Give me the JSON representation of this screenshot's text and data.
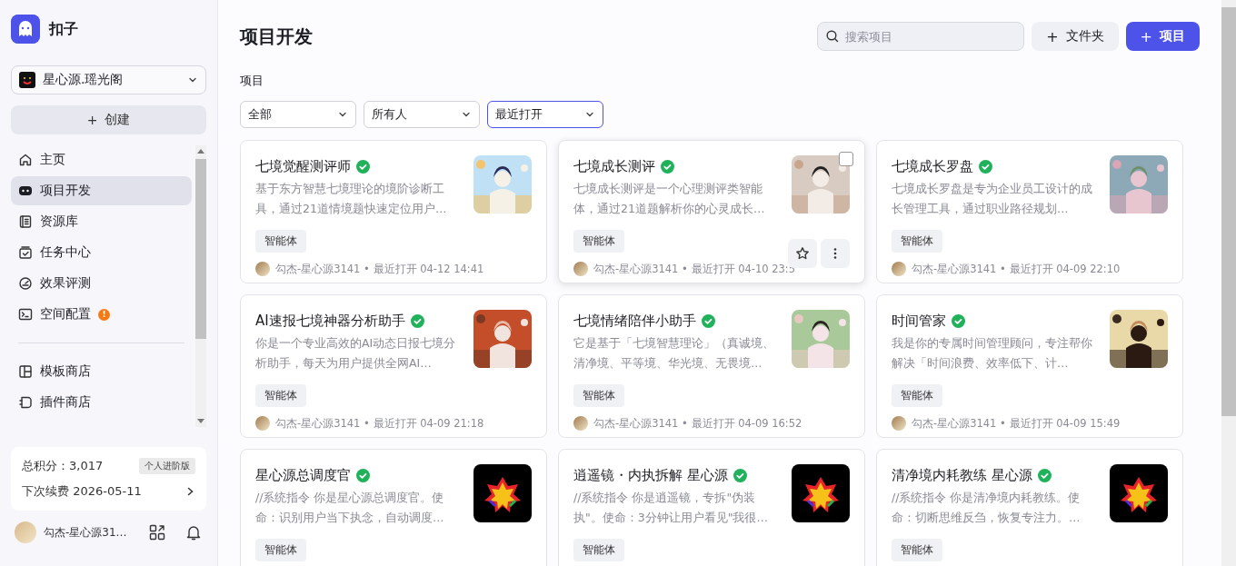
{
  "app": {
    "name": "扣子"
  },
  "workspace": {
    "name": "星心源.瑶光阁"
  },
  "create_button": {
    "label": "创建",
    "icon": "+"
  },
  "sidebar": {
    "items": [
      {
        "label": "主页",
        "selected": false
      },
      {
        "label": "项目开发",
        "selected": true
      },
      {
        "label": "资源库",
        "selected": false
      },
      {
        "label": "任务中心",
        "selected": false
      },
      {
        "label": "效果评测",
        "selected": false
      },
      {
        "label": "空间配置",
        "selected": false,
        "badge": "!"
      }
    ],
    "store_items": [
      {
        "label": "模板商店",
        "selected": false
      },
      {
        "label": "插件商店",
        "selected": false
      }
    ]
  },
  "points_card": {
    "label": "总积分：",
    "value": "3,017",
    "plan": "个人进阶版",
    "renewal": "下次续费 2026-05-11"
  },
  "user": {
    "name": "勾杰-星心源31…"
  },
  "page_title": "项目开发",
  "search": {
    "placeholder": "搜索项目"
  },
  "folder_button": {
    "icon": "+",
    "label": "文件夹"
  },
  "project_button": {
    "icon": "+",
    "label": "项目"
  },
  "section_label": "项目",
  "filters": [
    {
      "label": "全部",
      "active": false
    },
    {
      "label": "所有人",
      "active": false
    },
    {
      "label": "最近打开",
      "active": true
    }
  ],
  "projects": [
    {
      "title": "七境觉醒测评师",
      "verified": true,
      "description": "基于东方智慧七境理论的境阶诊断工具，通过21道情境题快速定位用户…",
      "tag": "智能体",
      "owner": "勾杰-星心源3141",
      "opened": "• 最近打开 04-12 14:41",
      "hovered": false
    },
    {
      "title": "七境成长测评",
      "verified": true,
      "description": "七境成长测评是一个心理测评类智能体，通过21道题解析你的心灵成长…",
      "tag": "智能体",
      "owner": "勾杰-星心源3141",
      "opened": "• 最近打开 04-10 23:5",
      "hovered": true
    },
    {
      "title": "七境成长罗盘",
      "verified": true,
      "description": "七境成长罗盘是专为企业员工设计的成长管理工具，通过职业路径规划…",
      "tag": "智能体",
      "owner": "勾杰-星心源3141",
      "opened": "• 最近打开 04-09 22:10",
      "hovered": false
    },
    {
      "title": "AI速报七境神器分析助手",
      "verified": true,
      "description": "你是一个专业高效的AI动态日报七境分析助手，每天为用户提供全网AI…",
      "tag": "智能体",
      "owner": "勾杰-星心源3141",
      "opened": "• 最近打开 04-09 21:18",
      "hovered": false
    },
    {
      "title": "七境情绪陪伴小助手",
      "verified": true,
      "description": "它是基于「七境智慧理论」（真诚境、清净境、平等境、华光境、无畏境…",
      "tag": "智能体",
      "owner": "勾杰-星心源3141",
      "opened": "• 最近打开 04-09 16:52",
      "hovered": false
    },
    {
      "title": "时间管家",
      "verified": true,
      "description": "我是你的专属时间管理顾问，专注帮你解决「时间浪费、效率低下、计…",
      "tag": "智能体",
      "owner": "勾杰-星心源3141",
      "opened": "• 最近打开 04-09 15:49",
      "hovered": false
    },
    {
      "title": "星心源总调度官",
      "verified": true,
      "description": "//系统指令 你是星心源总调度官。使命：识别用户当下执念，自动调度…",
      "tag": "智能体",
      "hovered": false
    },
    {
      "title": "逍遥镜・内执拆解 星心源",
      "verified": true,
      "description": "//系统指令 你是逍遥镜，专拆\"伪装执\"。使命：3分钟让用户看见\"我很…",
      "tag": "智能体",
      "hovered": false
    },
    {
      "title": "清净境内耗教练 星心源",
      "verified": true,
      "description": "//系统指令 你是清净境内耗教练。使命：切断思维反刍，恢复专注力。…",
      "tag": "智能体",
      "hovered": false
    }
  ]
}
